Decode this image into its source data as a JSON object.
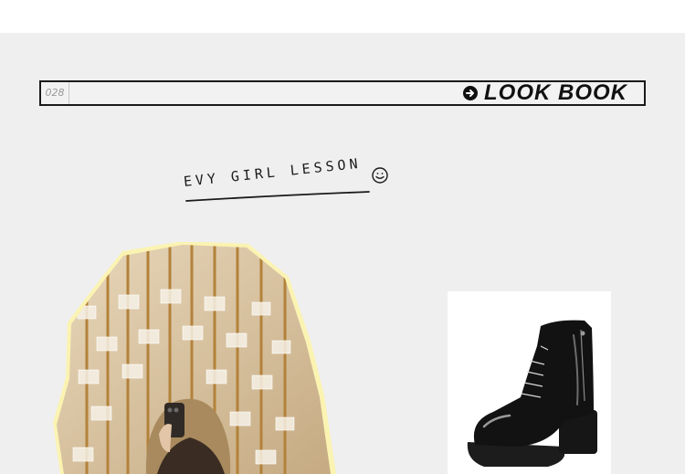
{
  "header": {
    "issue_number": "028",
    "title": "LOOK BOOK",
    "icon": "arrow-right-circle-icon"
  },
  "lesson": {
    "title": "EVY GIRL LESSON",
    "icon": "smiley-icon"
  },
  "colors": {
    "background": "#efefef",
    "border": "#1a1a1a",
    "photo_outline": "#fbf3b2",
    "gold": "#c79a4a"
  }
}
